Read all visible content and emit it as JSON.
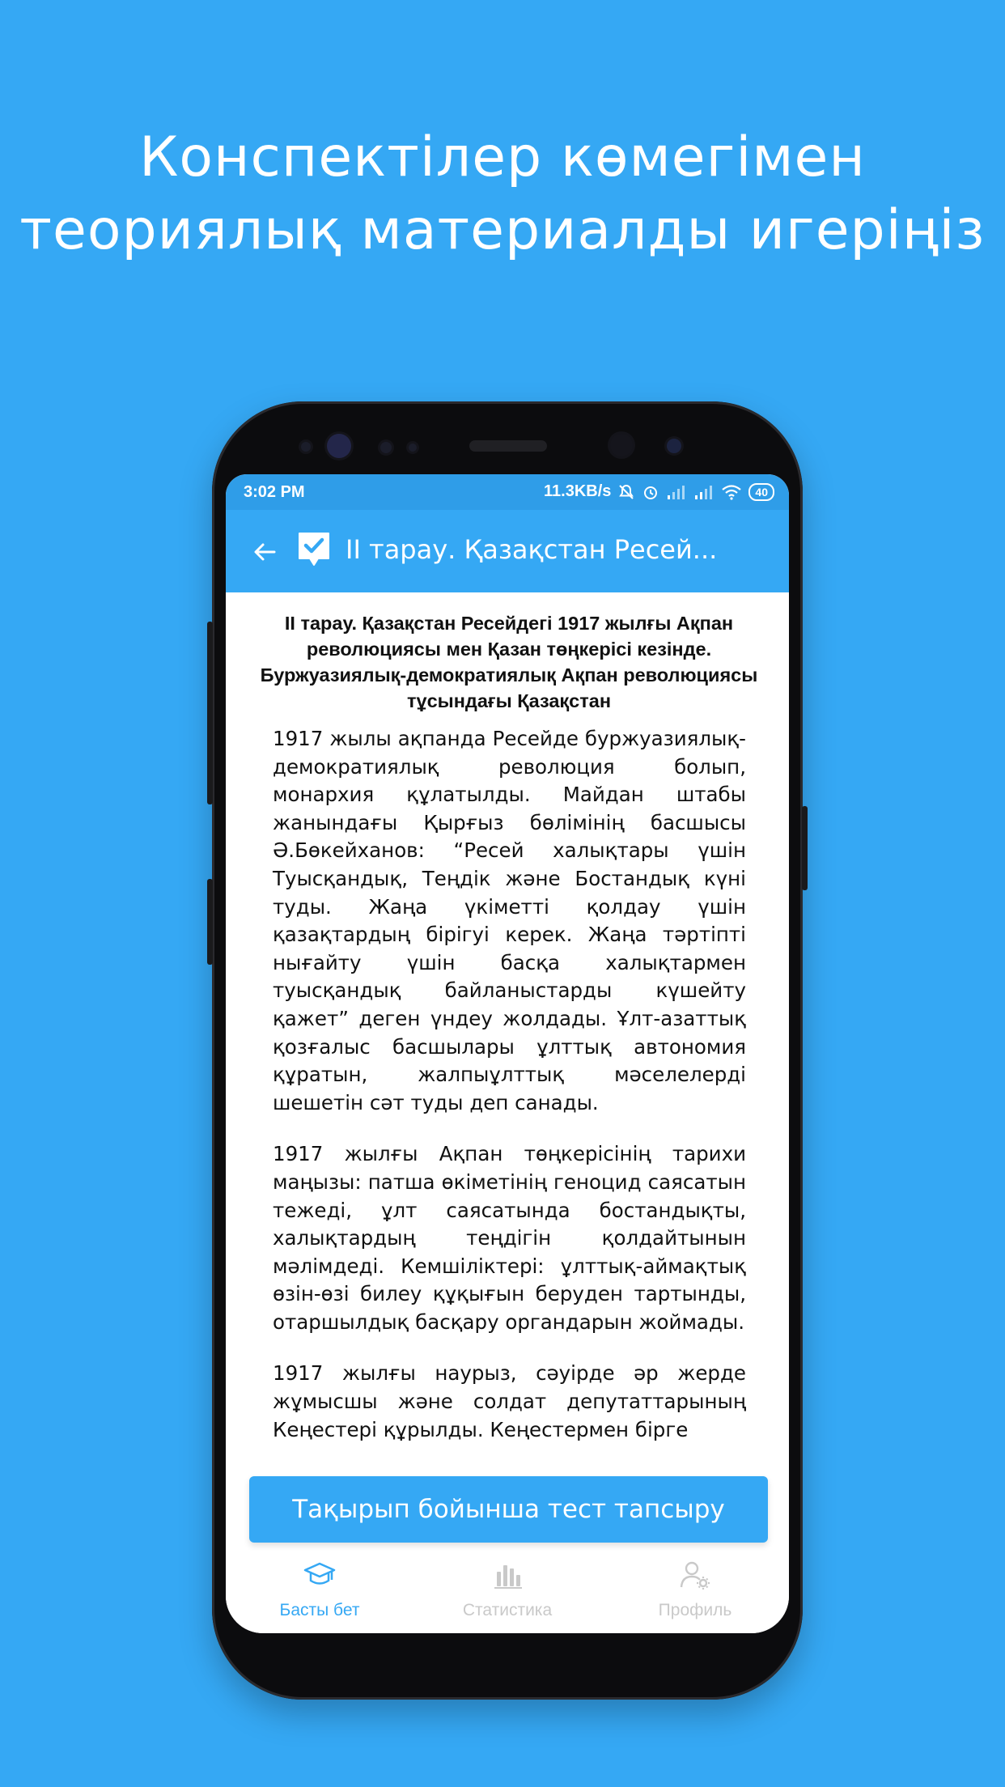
{
  "promo": {
    "line1": "Конспектілер көмегімен",
    "line2": "теориялық материалды игеріңіз"
  },
  "status_bar": {
    "time": "3:02 PM",
    "speed": "11.3KB/s",
    "battery": "40"
  },
  "app_bar": {
    "title": "II тарау. Қазақстан Ресей..."
  },
  "article": {
    "title": "II тарау. Қазақстан Ресейдегі 1917 жылғы Ақпан революциясы мен Қазан төңкерісі кезінде. Буржуазиялық-демократиялық Ақпан революциясы тұсындағы Қазақстан",
    "paragraphs": [
      "1917 жылы ақпанда Ресейде буржуазиялық-демократиялық революция болып, монархия құлатылды. Майдан штабы жанындағы Қырғыз бөлімінің басшысы Ә.Бөкейханов: “Ресей халықтары үшін Туысқандық, Теңдік және Бостандық күні туды. Жаңа үкіметті қолдау үшін қазақтардың бірігуі керек. Жаңа тәртіпті нығайту үшін басқа халықтармен туысқандық байланыстарды күшейту қажет” деген үндеу жолдады. Ұлт-азаттық қозғалыс басшылары ұлттық автономия құратын, жалпыұлттық мәселелерді шешетін сәт туды деп санады.",
      "1917 жылғы Ақпан төңкерісінің тарихи маңызы: патша өкіметінің геноцид саясатын тежеді, ұлт саясатында бостандықты, халықтардың теңдігін қолдайтынын мәлімдеді. Кемшіліктері: ұлттық-аймақтық өзін-өзі билеу құқығын беруден тартынды, отаршылдық басқару органдарын жоймады.",
      "1917 жылғы наурыз, сәуірде әр жерде жұмысшы және солдат депутаттарының Кеңестері құрылды. Кеңестермен бірге"
    ]
  },
  "test_button": {
    "label": "Тақырып бойынша тест тапсыру"
  },
  "bottom_nav": {
    "items": [
      {
        "label": "Басты бет",
        "icon": "graduation-cap-icon",
        "active": true
      },
      {
        "label": "Статистика",
        "icon": "bar-chart-icon",
        "active": false
      },
      {
        "label": "Профиль",
        "icon": "user-settings-icon",
        "active": false
      }
    ]
  },
  "colors": {
    "background": "#35a8f4",
    "app_bar": "#35a8f4",
    "status_bar": "#2f9de8",
    "nav_active": "#35a8f4",
    "nav_inactive": "#c9c9c9"
  }
}
